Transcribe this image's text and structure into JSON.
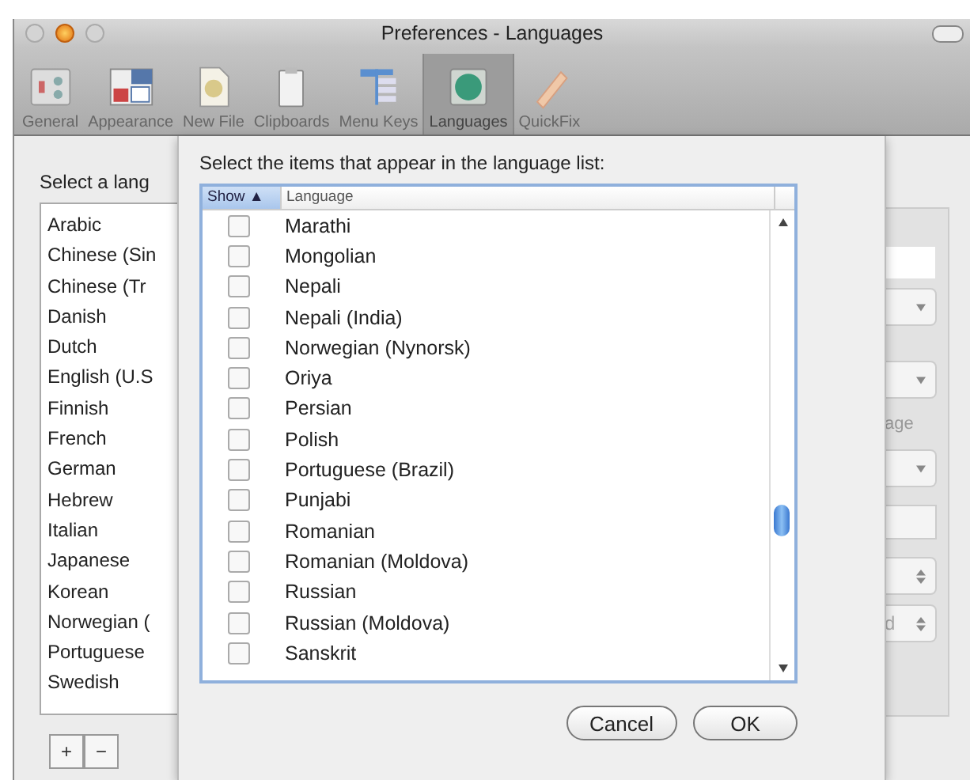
{
  "window": {
    "title": "Preferences - Languages"
  },
  "toolbar": [
    {
      "label": "General",
      "selected": false
    },
    {
      "label": "Appearance",
      "selected": false
    },
    {
      "label": "New File",
      "selected": false
    },
    {
      "label": "Clipboards",
      "selected": false
    },
    {
      "label": "Menu Keys",
      "selected": false
    },
    {
      "label": "Languages",
      "selected": true
    },
    {
      "label": "QuickFix",
      "selected": false
    }
  ],
  "language_pane": {
    "heading": "Select a lang",
    "items": [
      "Arabic",
      "Chinese (Sin",
      "Chinese (Tr",
      "Danish",
      "Dutch",
      "English (U.S",
      "Finnish",
      "French",
      "German",
      "Hebrew",
      "Italian",
      "Japanese",
      "Korean",
      "Norwegian (",
      "Portuguese",
      "Swedish"
    ],
    "add_button": "+",
    "remove_button": "−"
  },
  "settings_pane": {
    "label_1": "age",
    "stepper_value": "d"
  },
  "sheet": {
    "prompt": "Select the items that appear in the language list:",
    "columns": [
      {
        "label": "Show ▲",
        "selected": true
      },
      {
        "label": "Language",
        "selected": false
      }
    ],
    "rows": [
      {
        "language": "Marathi",
        "checked": false
      },
      {
        "language": "Mongolian",
        "checked": false
      },
      {
        "language": "Nepali",
        "checked": false
      },
      {
        "language": "Nepali (India)",
        "checked": false
      },
      {
        "language": "Norwegian (Nynorsk)",
        "checked": false
      },
      {
        "language": "Oriya",
        "checked": false
      },
      {
        "language": "Persian",
        "checked": false
      },
      {
        "language": "Polish",
        "checked": false
      },
      {
        "language": "Portuguese (Brazil)",
        "checked": false
      },
      {
        "language": "Punjabi",
        "checked": false
      },
      {
        "language": "Romanian",
        "checked": false
      },
      {
        "language": "Romanian (Moldova)",
        "checked": false
      },
      {
        "language": "Russian",
        "checked": false
      },
      {
        "language": "Russian (Moldova)",
        "checked": false
      },
      {
        "language": "Sanskrit",
        "checked": false
      }
    ],
    "buttons": [
      "Cancel",
      "OK"
    ]
  }
}
